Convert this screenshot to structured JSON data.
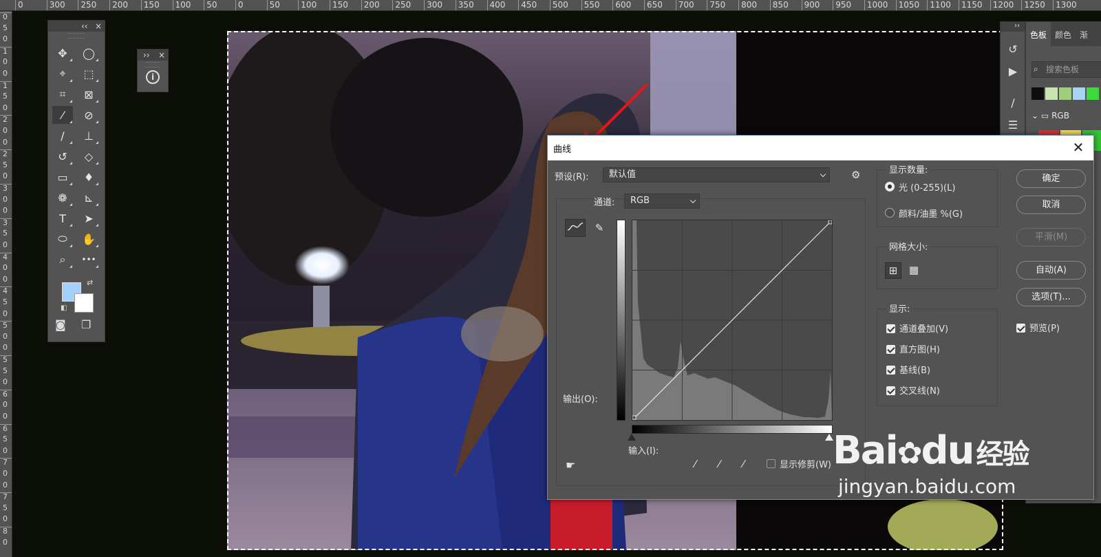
{
  "ruler": {
    "top_labels": [
      "0",
      "300",
      "250",
      "200",
      "150",
      "100",
      "50",
      "0",
      "50",
      "100",
      "150",
      "200",
      "250",
      "300",
      "350",
      "400",
      "450",
      "500",
      "550",
      "600",
      "650",
      "700",
      "750",
      "800",
      "850",
      "900",
      "950",
      "1000",
      "1050",
      "1100",
      "1150",
      "1200",
      "1250",
      "1300"
    ],
    "left_labels": [
      "0",
      "5",
      "0",
      "1",
      "0",
      "0",
      "1",
      "5",
      "0",
      "2",
      "0",
      "0",
      "2",
      "5",
      "0",
      "3",
      "0",
      "0",
      "3",
      "5",
      "0",
      "4",
      "0",
      "0",
      "4",
      "5",
      "0",
      "5",
      "0",
      "0",
      "5",
      "5",
      "0",
      "6",
      "0",
      "0",
      "6",
      "5",
      "0",
      "7",
      "0",
      "0",
      "7",
      "5",
      "0",
      "8",
      "0"
    ]
  },
  "toolbar": {
    "collapse": "‹‹",
    "close": "×",
    "tools": [
      {
        "name": "move-tool",
        "glyph": "✥"
      },
      {
        "name": "ellipse-marquee-tool",
        "glyph": "◯"
      },
      {
        "name": "polygonal-lasso-tool",
        "glyph": "⌖"
      },
      {
        "name": "object-selection-tool",
        "glyph": "⬚"
      },
      {
        "name": "crop-tool",
        "glyph": "⌗"
      },
      {
        "name": "frame-tool",
        "glyph": "⊠"
      },
      {
        "name": "eyedropper-tool",
        "glyph": "⁄"
      },
      {
        "name": "healing-brush-tool",
        "glyph": "⊘"
      },
      {
        "name": "brush-tool",
        "glyph": "∕"
      },
      {
        "name": "clone-stamp-tool",
        "glyph": "⊥"
      },
      {
        "name": "history-brush-tool",
        "glyph": "↺"
      },
      {
        "name": "eraser-tool",
        "glyph": "◇"
      },
      {
        "name": "gradient-tool",
        "glyph": "▭"
      },
      {
        "name": "blur-tool",
        "glyph": "♦"
      },
      {
        "name": "dodge-tool",
        "glyph": "❁"
      },
      {
        "name": "pen-tool",
        "glyph": "⊾"
      },
      {
        "name": "type-tool",
        "glyph": "T"
      },
      {
        "name": "path-selection-tool",
        "glyph": "➤"
      },
      {
        "name": "ellipse-tool",
        "glyph": "⬭"
      },
      {
        "name": "hand-tool",
        "glyph": "✋"
      },
      {
        "name": "zoom-tool",
        "glyph": "⌕"
      },
      {
        "name": "more-tools",
        "glyph": "•••"
      }
    ],
    "foreground_color": "#a3d1fb",
    "background_color": "#ffffff"
  },
  "info_panel": {
    "collapse": "››",
    "close": "×",
    "icon": "i"
  },
  "swatches": {
    "tabs": [
      "色板",
      "颜色",
      "渐"
    ],
    "search_placeholder": "搜索色板",
    "folder_label": "RGB",
    "row_colors": [
      "#0d0d0d",
      "#c9e3b3",
      "#9fcf7c",
      "#a8d3f3",
      "#3fd93f"
    ],
    "folder_colors": [
      "#d93030",
      "#f0d64a",
      "#35c235"
    ]
  },
  "dialog": {
    "title": "曲线",
    "preset_label": "预设(R):",
    "preset_value": "默认值",
    "channel_label": "通道:",
    "channel_value": "RGB",
    "output_label": "输出(O):",
    "input_label": "输入(I):",
    "show_clipping_label": "显示修剪(W)",
    "display_amount_title": "显示数量:",
    "light_label": "光 (0-255)(L)",
    "pigment_label": "颜料/油墨 %(G)",
    "grid_size_title": "网格大小:",
    "show_title": "显示:",
    "channel_overlay_label": "通道叠加(V)",
    "histogram_label": "直方图(H)",
    "baseline_label": "基线(B)",
    "intersection_label": "交叉线(N)",
    "ok_label": "确定",
    "cancel_label": "取消",
    "smooth_label": "平滑(M)",
    "auto_label": "自动(A)",
    "options_label": "选项(T)...",
    "preview_label": "预览(P)"
  },
  "watermark": {
    "brand": "Bai",
    "paw": "du",
    "cn": "经验",
    "url": "jingyan.baidu.com"
  }
}
